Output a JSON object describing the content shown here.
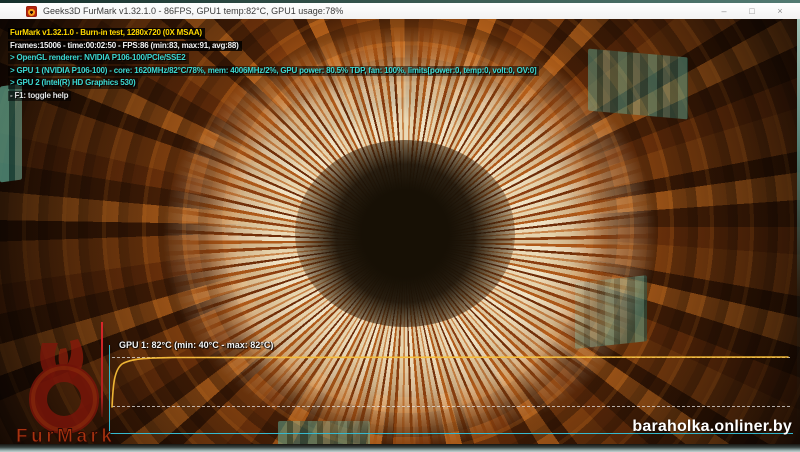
{
  "window": {
    "title": "Geeks3D FurMark v1.32.1.0 - 86FPS, GPU1 temp:82°C, GPU1 usage:78%",
    "controls": {
      "minimize": "–",
      "maximize": "□",
      "close": "×"
    }
  },
  "hud": {
    "lines": [
      {
        "text": "FurMark v1.32.1.0 - Burn-in test, 1280x720 (0X MSAA)",
        "color": "#ffd800"
      },
      {
        "text": "Frames:15006 - time:00:02:50 - FPS:86 (min:83, max:91, avg:88)",
        "color": "#f2f2f2"
      },
      {
        "text": "> OpenGL renderer: NVIDIA P106-100/PCIe/SSE2",
        "color": "#3cd8d2"
      },
      {
        "text": "> GPU 1 (NVIDIA P106-100) - core: 1620MHz/82°C/78%, mem: 4006MHz/2%, GPU power: 80.5% TDP, fan: 100%, limits[power:0, temp:0, volt:0, OV:0]",
        "color": "#3cd8d2"
      },
      {
        "text": "> GPU 2 (Intel(R) HD Graphics 530)",
        "color": "#3cd8d2"
      },
      {
        "text": "- F1: toggle help",
        "color": "#e0e0e0"
      }
    ]
  },
  "graph": {
    "label": "GPU 1: 82°C (min: 40°C - max: 82°C)",
    "colors": {
      "axis": "#35b9cf",
      "marker": "#d8262a",
      "curve": "#f7bd38",
      "dashed": "#e1e1e1"
    }
  },
  "logo": {
    "text": "FurMark"
  },
  "watermark": {
    "text": "baraholka.onliner.by"
  }
}
